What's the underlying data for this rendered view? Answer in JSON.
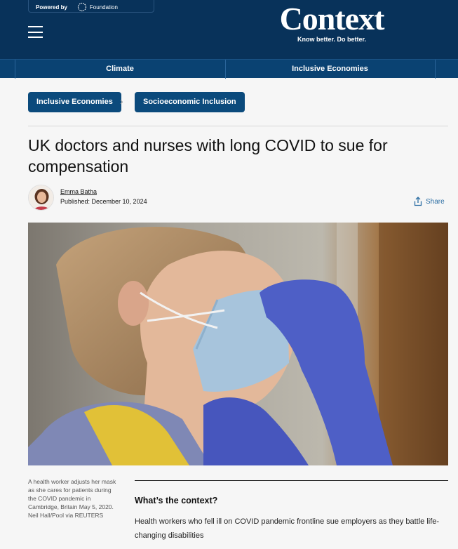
{
  "header": {
    "powered_label": "Powered by",
    "foundation_label": "Foundation",
    "logo_text": "Context",
    "tagline": "Know better. Do better."
  },
  "nav": {
    "items": [
      {
        "label": "Climate"
      },
      {
        "label": "Inclusive Economies"
      }
    ]
  },
  "breadcrumb": {
    "items": [
      {
        "label": "Inclusive Economies"
      },
      {
        "label": "Socioeconomic Inclusion"
      }
    ],
    "separator": "›"
  },
  "article": {
    "title": "UK doctors and nurses with long COVID to sue for compensation",
    "author": "Emma Batha",
    "published": "Published: December 10, 2024",
    "share_label": "Share",
    "image_caption": "A health worker adjusts her mask as she cares for patients during the COVID pandemic in Cambridge, Britain May 5, 2020. Neil Hall/Pool via REUTERS",
    "context_heading": "What’s the context?",
    "context_body": "Health workers who fell ill on COVID pandemic frontline sue employers as they battle life-changing disabilities"
  },
  "icons": {
    "menu": "hamburger-menu-icon",
    "share": "share-icon",
    "chevron": "chevron-right-icon"
  },
  "colors": {
    "header_bg": "#08325a",
    "nav_bg": "#0a4272",
    "pill_bg": "#0b4a7c",
    "link_blue": "#2c6ea3"
  }
}
